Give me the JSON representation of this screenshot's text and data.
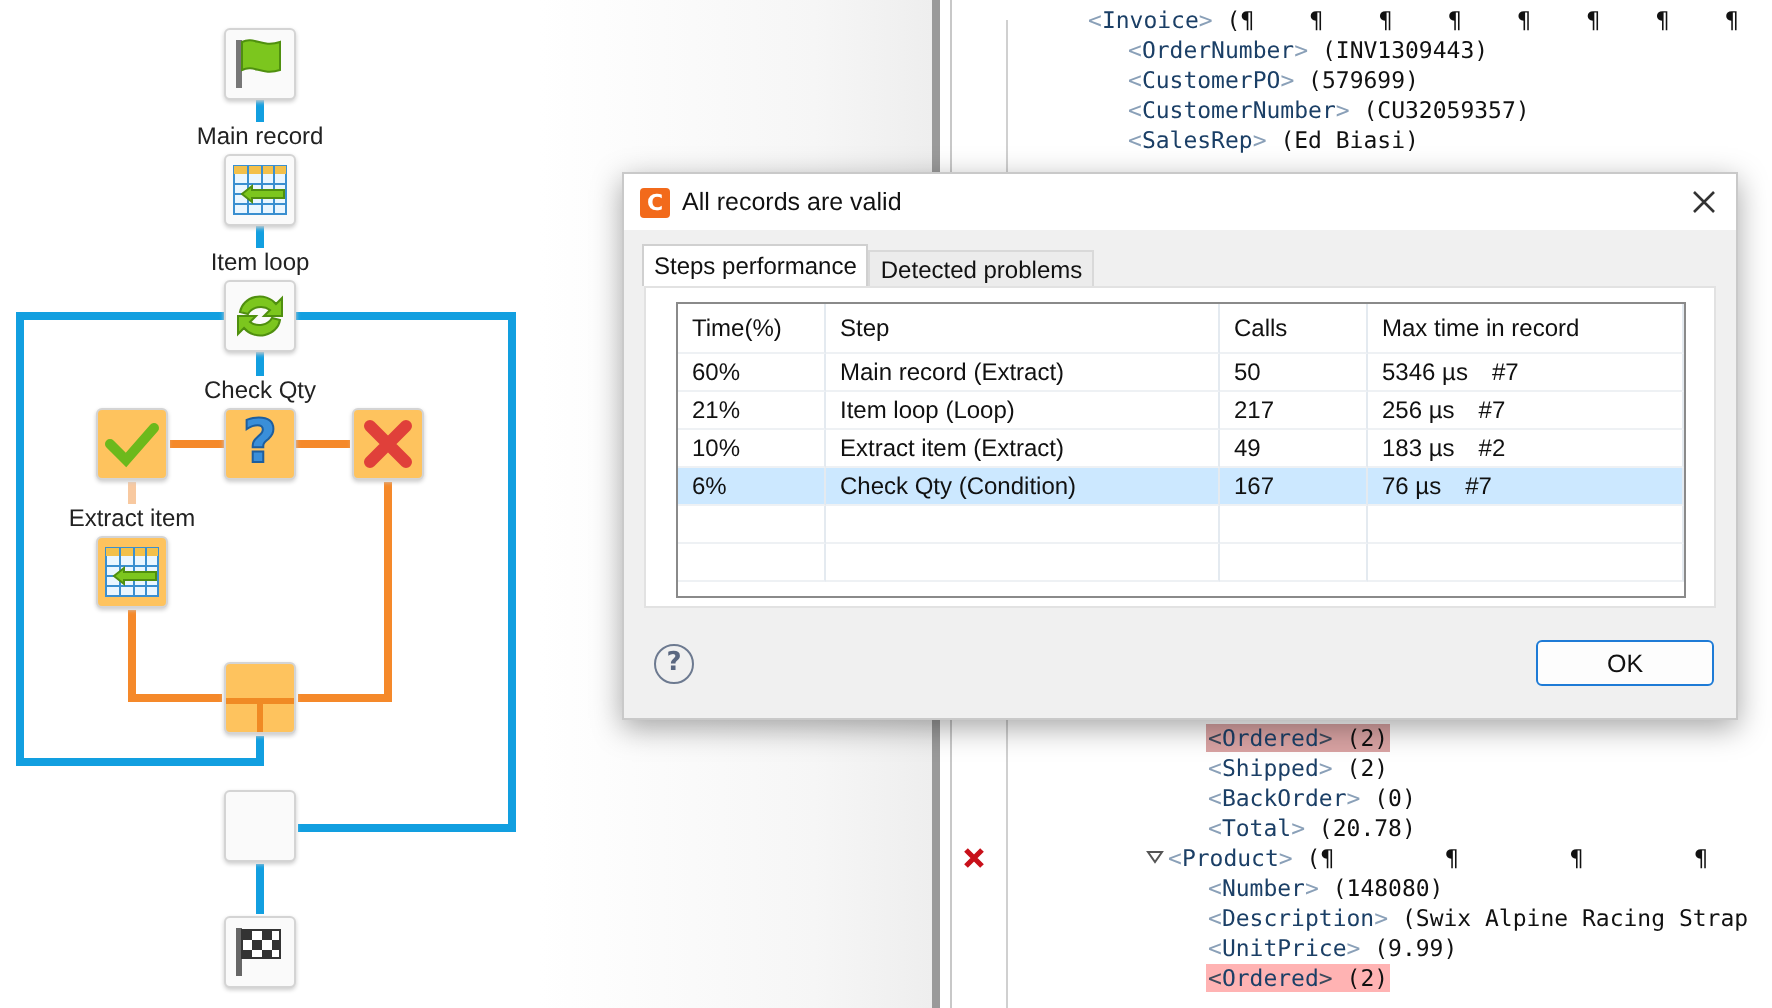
{
  "diagram": {
    "nodes": [
      {
        "kind": "start",
        "in_branch": false
      },
      {
        "kind": "extract",
        "label": "Main record",
        "in_branch": false
      },
      {
        "kind": "loop",
        "label": "Item loop",
        "in_branch": false
      },
      {
        "kind": "condition",
        "label": "Check Qty",
        "symbol": "?",
        "in_branch": true
      },
      {
        "kind": "true",
        "in_branch": true
      },
      {
        "kind": "false",
        "in_branch": true
      },
      {
        "kind": "extract",
        "label": "Extract item",
        "in_branch": true
      },
      {
        "kind": "join",
        "in_branch": true
      },
      {
        "kind": "loop_end",
        "in_branch": false
      },
      {
        "kind": "finish",
        "in_branch": false
      }
    ]
  },
  "editor": {
    "upper_lines": [
      {
        "tag": "<Invoice>",
        "value": "(¶    ¶    ¶    ¶    ¶    ¶    ¶    ¶",
        "children": [
          {
            "tag": "<OrderNumber>",
            "value": "(INV1309443)"
          },
          {
            "tag": "<CustomerPO>",
            "value": "(579699)"
          },
          {
            "tag": "<CustomerNumber>",
            "value": "(CU32059357)"
          },
          {
            "tag": "<SalesRep>",
            "value": "(Ed Biasi)"
          }
        ]
      }
    ],
    "lower_tail": [
      {
        "tag": "<Ordered>",
        "value": "(2)",
        "color": "#d9a3a3"
      },
      {
        "tag": "<Shipped>",
        "value": "(2)"
      },
      {
        "tag": "<BackOrder>",
        "value": "(0)"
      },
      {
        "tag": "<Total>",
        "value": "(20.78)"
      }
    ],
    "lower_nodes": [
      {
        "tag": "<Product>",
        "value": "(¶        ¶        ¶        ¶",
        "expanded": true,
        "error": true,
        "children": [
          {
            "tag": "<Number>",
            "value": "(148080)"
          },
          {
            "tag": "<Description>",
            "value": "(Swix Alpine Racing Strap"
          },
          {
            "tag": "<UnitPrice>",
            "value": "(9.99)"
          },
          {
            "tag": "<Ordered>",
            "value": "(2)",
            "color": "#ffb3b3"
          }
        ]
      }
    ]
  },
  "dialog": {
    "title": "All records are valid",
    "app_icon": "C",
    "tabs": [
      {
        "label": "Steps performance",
        "selected": true
      },
      {
        "label": "Detected problems",
        "selected": false
      }
    ],
    "table": {
      "columns": [
        "Time(%)",
        "Step",
        "Calls",
        "Max time in record"
      ],
      "rows": [
        {
          "time": "60%",
          "step": "Main record (Extract)",
          "calls": "50",
          "max_time": "5346 µs",
          "record": "#7",
          "selected": false
        },
        {
          "time": "21%",
          "step": "Item loop (Loop)",
          "calls": "217",
          "max_time": "256 µs",
          "record": "#7",
          "selected": false
        },
        {
          "time": "10%",
          "step": "Extract item (Extract)",
          "calls": "49",
          "max_time": "183 µs",
          "record": "#2",
          "selected": false
        },
        {
          "time": "6%",
          "step": "Check Qty (Condition)",
          "calls": "167",
          "max_time": "76 µs",
          "record": "#7",
          "selected": true
        }
      ]
    },
    "help": {
      "symbol": "?"
    },
    "ok_button": "OK"
  }
}
